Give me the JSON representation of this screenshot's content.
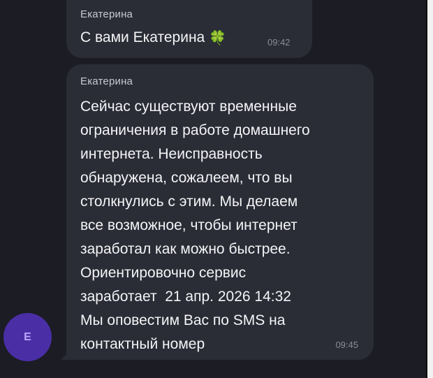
{
  "messages": [
    {
      "sender": "Екатерина",
      "text": "С вами Екатерина",
      "emoji": "🍀",
      "time": "09:42"
    },
    {
      "sender": "Екатерина",
      "lines": [
        "Сейчас существуют временные",
        "ограничения в работе домашнего",
        "интернета. Неисправность",
        "обнаружена, сожалеем, что вы",
        "столкнулись с этим. Мы делаем",
        "все возможное, чтобы интернет",
        "заработал как можно быстрее.",
        "Ориентировочно сервис",
        "заработает  21 апр. 2026 14:32",
        "Мы оповестим Вас по SMS на",
        "контактный номер"
      ],
      "time": "09:45"
    }
  ],
  "avatar": {
    "initial": "Е"
  },
  "colors": {
    "background": "#1b1c24",
    "bubble": "#2a2c36",
    "avatar": "#4a2ea6",
    "avatar_text": "#b9a8ff",
    "emoji": "#3fae3a"
  }
}
